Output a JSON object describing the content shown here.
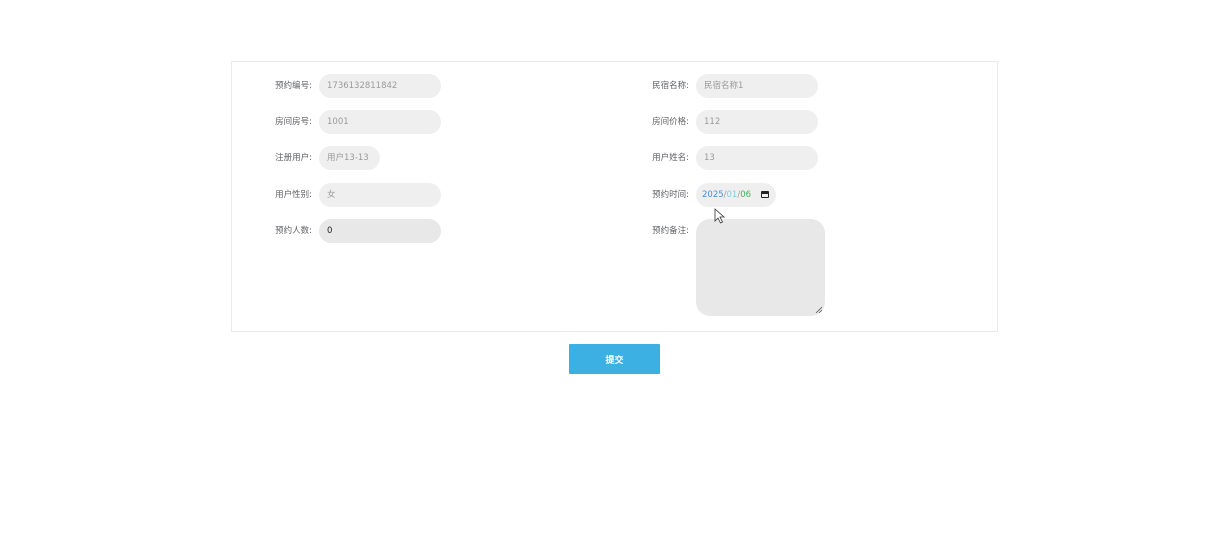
{
  "form": {
    "left_fields": [
      {
        "label": "预约编号:",
        "value": "1736132811842"
      },
      {
        "label": "房间房号:",
        "value": "1001"
      },
      {
        "label": "注册用户:",
        "value": "用户13-13"
      },
      {
        "label": "用户性别:",
        "value": "女"
      },
      {
        "label": "预约人数:",
        "value": "0"
      }
    ],
    "right_fields": [
      {
        "label": "民宿名称:",
        "value": "民宿名称1"
      },
      {
        "label": "房间价格:",
        "value": "112"
      },
      {
        "label": "用户姓名:",
        "value": "13"
      }
    ],
    "reservation_time": {
      "label": "预约时间:",
      "year": "2025",
      "month": "01",
      "day": "06",
      "separator": "/"
    },
    "remark": {
      "label": "预约备注:",
      "value": ""
    }
  },
  "submit_label": "提交",
  "icons": {
    "date_picker": "calendar-icon",
    "resize": "resize-grip-icon",
    "pointer": "mouse-cursor-icon"
  }
}
